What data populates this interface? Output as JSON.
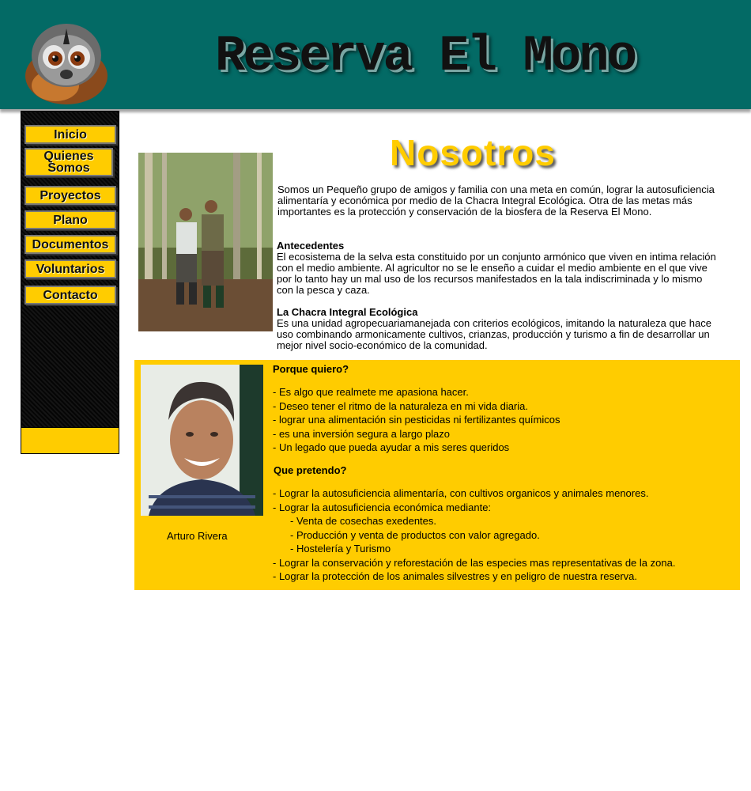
{
  "header": {
    "title": "Reserva El Mono",
    "logo_icon": "monkey-face-logo",
    "background": "#036a65"
  },
  "nav": {
    "items": [
      {
        "label": "Inicio"
      },
      {
        "label": "Quienes Somos"
      },
      {
        "label": "Proyectos"
      },
      {
        "label": "Plano"
      },
      {
        "label": "Documentos"
      },
      {
        "label": "Voluntarios"
      },
      {
        "label": "Contacto"
      }
    ],
    "accent": "#ffcc00"
  },
  "main": {
    "heading": "Nosotros",
    "intro": "Somos un Pequeño grupo de amigos y familia con una meta en común, lograr la autosuficiencia alimentaría y económica por medio de la Chacra Integral Ecológica. Otra de las metas más importantes es la protección y conservación de la biosfera de la Reserva El Mono.",
    "antecedentes_title": "Antecedentes",
    "antecedentes_text": "El ecosistema de la selva esta constituido por un conjunto armónico que viven en intima relación con el medio ambiente. Al agricultor no se le enseño a cuidar el medio ambiente en el que vive por lo tanto hay un mal uso de los recursos manifestados en la tala indiscriminada y lo mismo con la pesca y caza.",
    "chacra_title": "La Chacra Integral Ecológica",
    "chacra_text": "Es una unidad agropecuariamanejada con criterios ecológicos, imitando la naturaleza que hace uso combinando armonicamente cultivos, crianzas, producción y turismo a fin de desarrollar un mejor nivel socio-económico de la comunidad."
  },
  "profile": {
    "name": "Arturo Rivera",
    "porque_title": "Porque quiero?",
    "porque_items": [
      "- Es algo que realmete me apasiona hacer.",
      "- Deseo tener el ritmo de la naturaleza en mi vida diaria.",
      "- lograr una alimentación sin pesticidas ni fertilizantes químicos",
      "- es una inversión segura a largo plazo",
      "- Un legado que pueda ayudar a mis seres  queridos"
    ],
    "pretendo_title": "Que pretendo?",
    "pretendo_items": [
      "- Lograr la autosuficiencia alimentaría, con cultivos organicos y animales menores.",
      "- Lograr la autosuficiencia económica mediante:",
      "- Venta de cosechas exedentes.",
      "- Producción y venta de productos con valor agregado.",
      "- Hostelería y Turismo",
      "- Lograr la conservación y reforestación de las especies mas representativas de la zona.",
      "- Lograr la protección de los animales silvestres y en peligro de nuestra reserva."
    ]
  }
}
